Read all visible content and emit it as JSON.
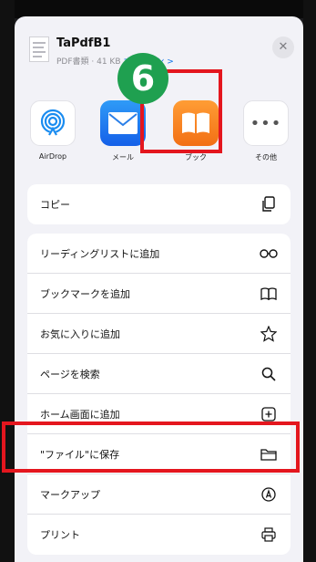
{
  "file": {
    "title": "TaPdfB1",
    "meta": "PDF書類 · 41 KB",
    "options_link": "オプション >"
  },
  "step_number": "6",
  "apps": [
    {
      "label": "AirDrop",
      "icon": "airdrop-icon"
    },
    {
      "label": "メール",
      "icon": "mail-icon"
    },
    {
      "label": "ブック",
      "icon": "books-icon"
    },
    {
      "label": "その他",
      "icon": "more-icon"
    }
  ],
  "copy_group": [
    {
      "label": "コピー",
      "icon": "copy-icon"
    }
  ],
  "actions": [
    {
      "label": "リーディングリストに追加",
      "icon": "glasses-icon"
    },
    {
      "label": "ブックマークを追加",
      "icon": "book-open-icon"
    },
    {
      "label": "お気に入りに追加",
      "icon": "star-icon"
    },
    {
      "label": "ページを検索",
      "icon": "search-icon"
    },
    {
      "label": "ホーム画面に追加",
      "icon": "plus-square-icon"
    },
    {
      "label": "\"ファイル\"に保存",
      "icon": "folder-icon"
    },
    {
      "label": "マークアップ",
      "icon": "markup-icon"
    },
    {
      "label": "プリント",
      "icon": "print-icon"
    }
  ],
  "colors": {
    "highlight": "#e4161e",
    "step_badge": "#1fa050",
    "link": "#0a72e8"
  }
}
